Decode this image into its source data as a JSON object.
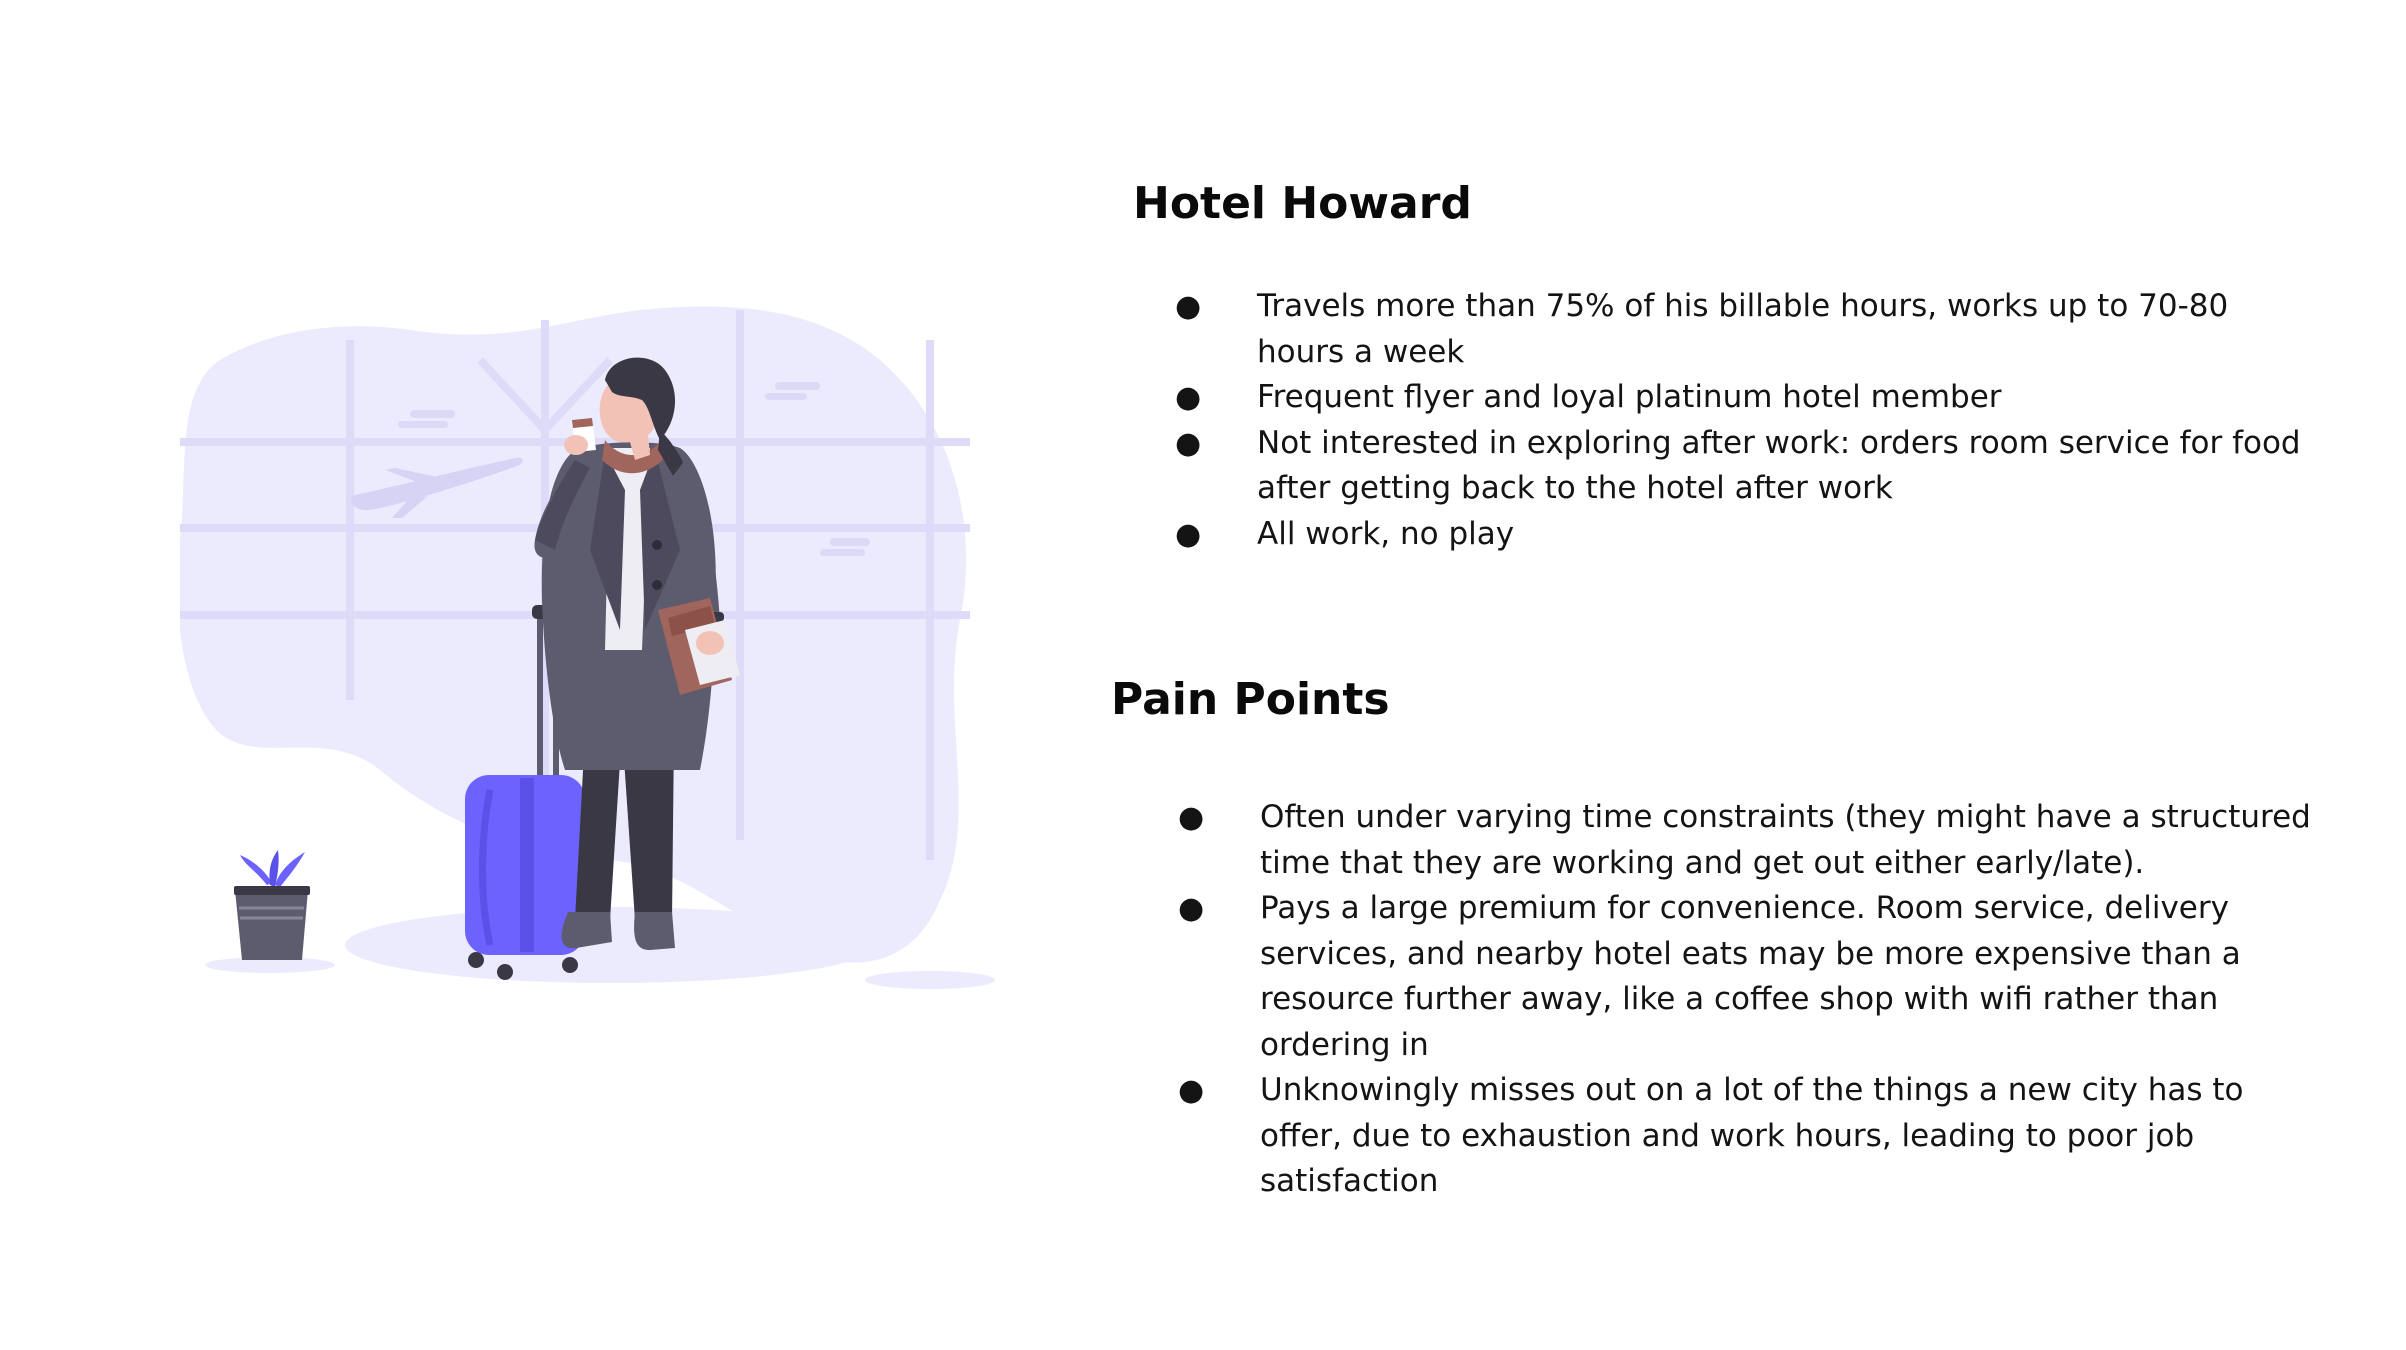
{
  "persona": {
    "name": "Hotel Howard",
    "bullets": [
      "Travels more than 75% of his billable hours, works up to 70-80 hours a week",
      "Frequent flyer and loyal platinum hotel member",
      "Not interested in exploring after work: orders room service for food after getting back to the hotel after work",
      "All work, no play"
    ]
  },
  "pain_points": {
    "title": "Pain Points",
    "bullets": [
      "Often under varying time constraints (they might have a structured time that they are working and get out either early/late).",
      "Pays a large premium for convenience. Room service, delivery services, and nearby hotel eats may be more expensive than a resource further away, like a coffee shop with wifi rather than ordering in",
      "Unknowingly misses out on a lot of the things a new city has to offer, due to exhaustion and work hours, leading to poor job satisfaction"
    ]
  },
  "bullet_glyph": "●",
  "illustration": {
    "subject": "traveler-with-suitcase",
    "colors": {
      "accent": "#6c63ff",
      "blob": "#eceafd",
      "coat": "#5d5b6e",
      "trousers": "#3b3846",
      "folder": "#a0655c"
    }
  }
}
